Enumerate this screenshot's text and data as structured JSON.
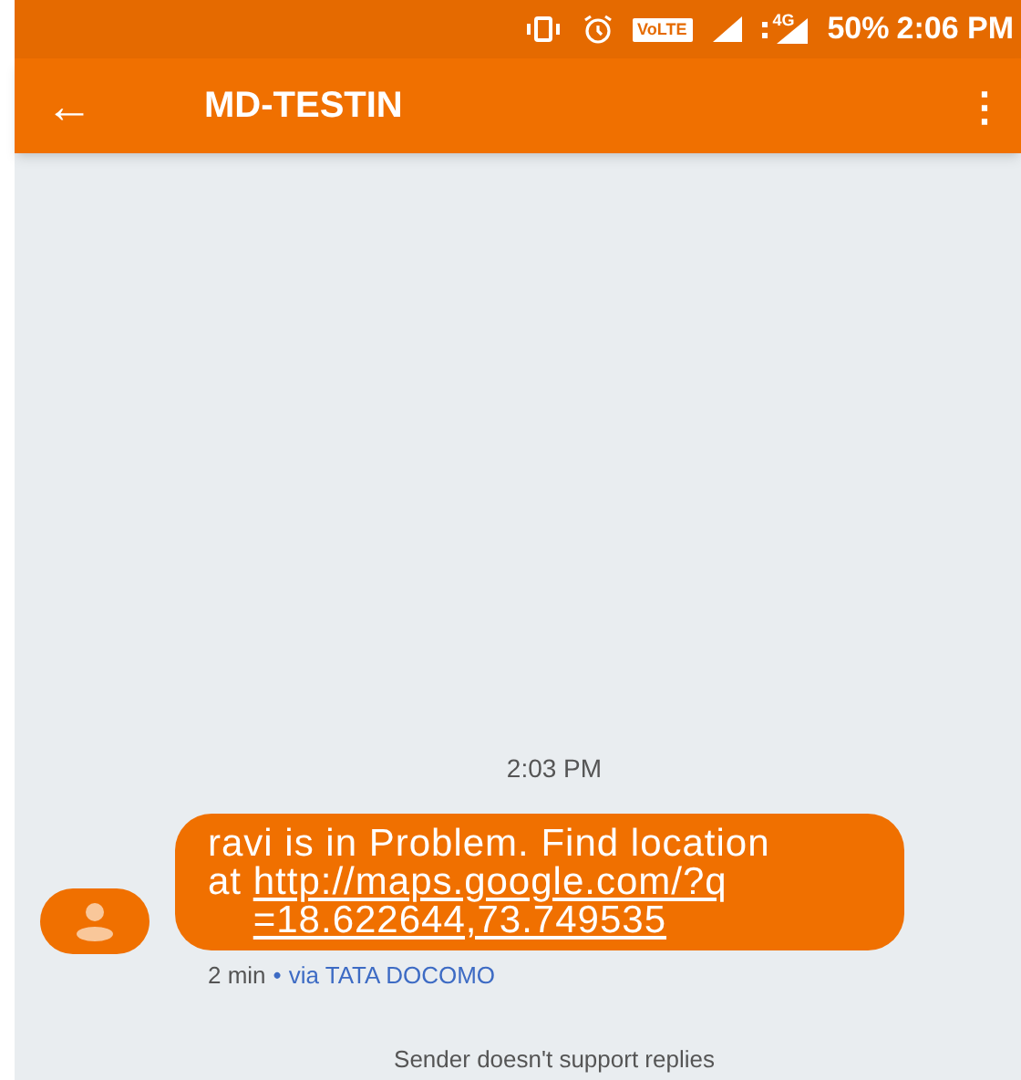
{
  "status_bar": {
    "volte": "VoLTE",
    "network": "4G",
    "battery": "50%",
    "time": "2:06 PM"
  },
  "app_bar": {
    "back": "←",
    "title": "MD-TESTIN",
    "menu": "⋮"
  },
  "conversation": {
    "timestamp": "2:03 PM",
    "message": {
      "text": "ravi is in Problem. Find location at",
      "link": "http://maps.google.com/?q=18.622644,73.749535",
      "age": "2 min",
      "separator": "•",
      "via": "via TATA DOCOMO"
    },
    "footer": "Sender doesn't support replies"
  }
}
